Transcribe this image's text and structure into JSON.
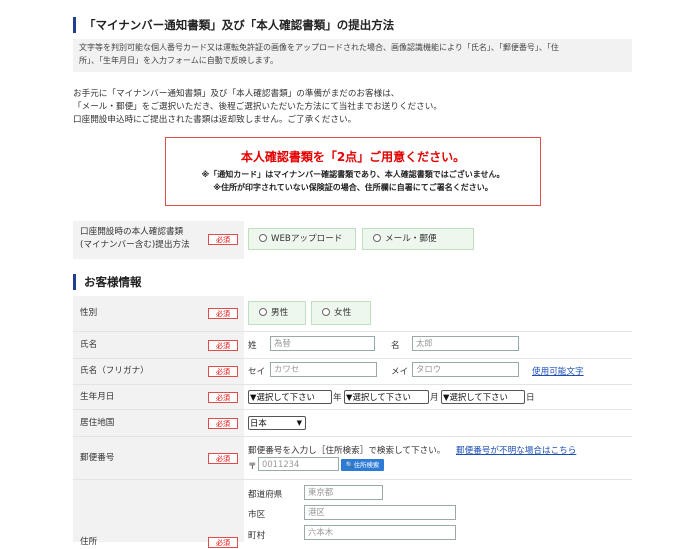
{
  "submission": {
    "heading": "「マイナンバー通知書類」及び「本人確認書類」の提出方法",
    "note_line1": "文字等を判別可能な個人番号カード又は運転免許証の画像をアップロードされた場合、画像認識機能により「氏名」、「郵便番号」、「住",
    "note_line2": "所」、「生年月日」を入力フォームに自動で反映します。",
    "intro_line1": "お手元に「マイナンバー通知書類」及び「本人確認書類」の準備がまだのお客様は、",
    "intro_line2": "「メール・郵便」をご選択いただき、後程ご選択いただいた方法にて当社までお送りください。",
    "intro_line3": "口座開設申込時にご提出された書類は返却致しません。ご了承ください。",
    "alert_title": "本人確認書類を「2点」ご用意ください。",
    "alert_line1": "※「通知カード」はマイナンバー確認書類であり、本人確認書類ではございません。",
    "alert_line2": "※住所が印字されていない保険証の場合、住所欄に自署にてご署名ください。",
    "method_label_line1": "口座開設時の本人確認書類",
    "method_label_line2": "(マイナンバー含む)提出方法",
    "method_options": [
      "WEBアップロード",
      "メール・郵便"
    ]
  },
  "required_label": "必須",
  "customer": {
    "heading": "お客様情報",
    "gender_label": "性別",
    "gender_options": [
      "男性",
      "女性"
    ],
    "name_label": "氏名",
    "sei_label": "姓",
    "mei_label": "名",
    "sei_placeholder": "為替",
    "mei_placeholder": "太郎",
    "kana_label": "氏名（フリガナ）",
    "kana_sei_label": "セイ",
    "kana_mei_label": "メイ",
    "kana_sei_placeholder": "カワセ",
    "kana_mei_placeholder": "タロウ",
    "usable_chars_link": "使用可能文字",
    "birth_label": "生年月日",
    "select_placeholder": "▼選択して下さい",
    "year_unit": "年",
    "month_unit": "月",
    "day_unit": "日",
    "country_label": "居住地国",
    "country_value": "日本",
    "zip_label": "郵便番号",
    "zip_instruction": "郵便番号を入力し［住所検索］で検索して下さい。",
    "zip_unknown_link": "郵便番号が不明な場合はこちら",
    "zip_mark": "〒",
    "zip_placeholder": "0011234",
    "zip_search_button": "住所検索",
    "address_label": "住所",
    "prefecture_label": "都道府県",
    "prefecture_placeholder": "東京都",
    "city_label": "市区",
    "city_placeholder": "港区",
    "town_label": "町村",
    "town_placeholder": "六本木"
  }
}
